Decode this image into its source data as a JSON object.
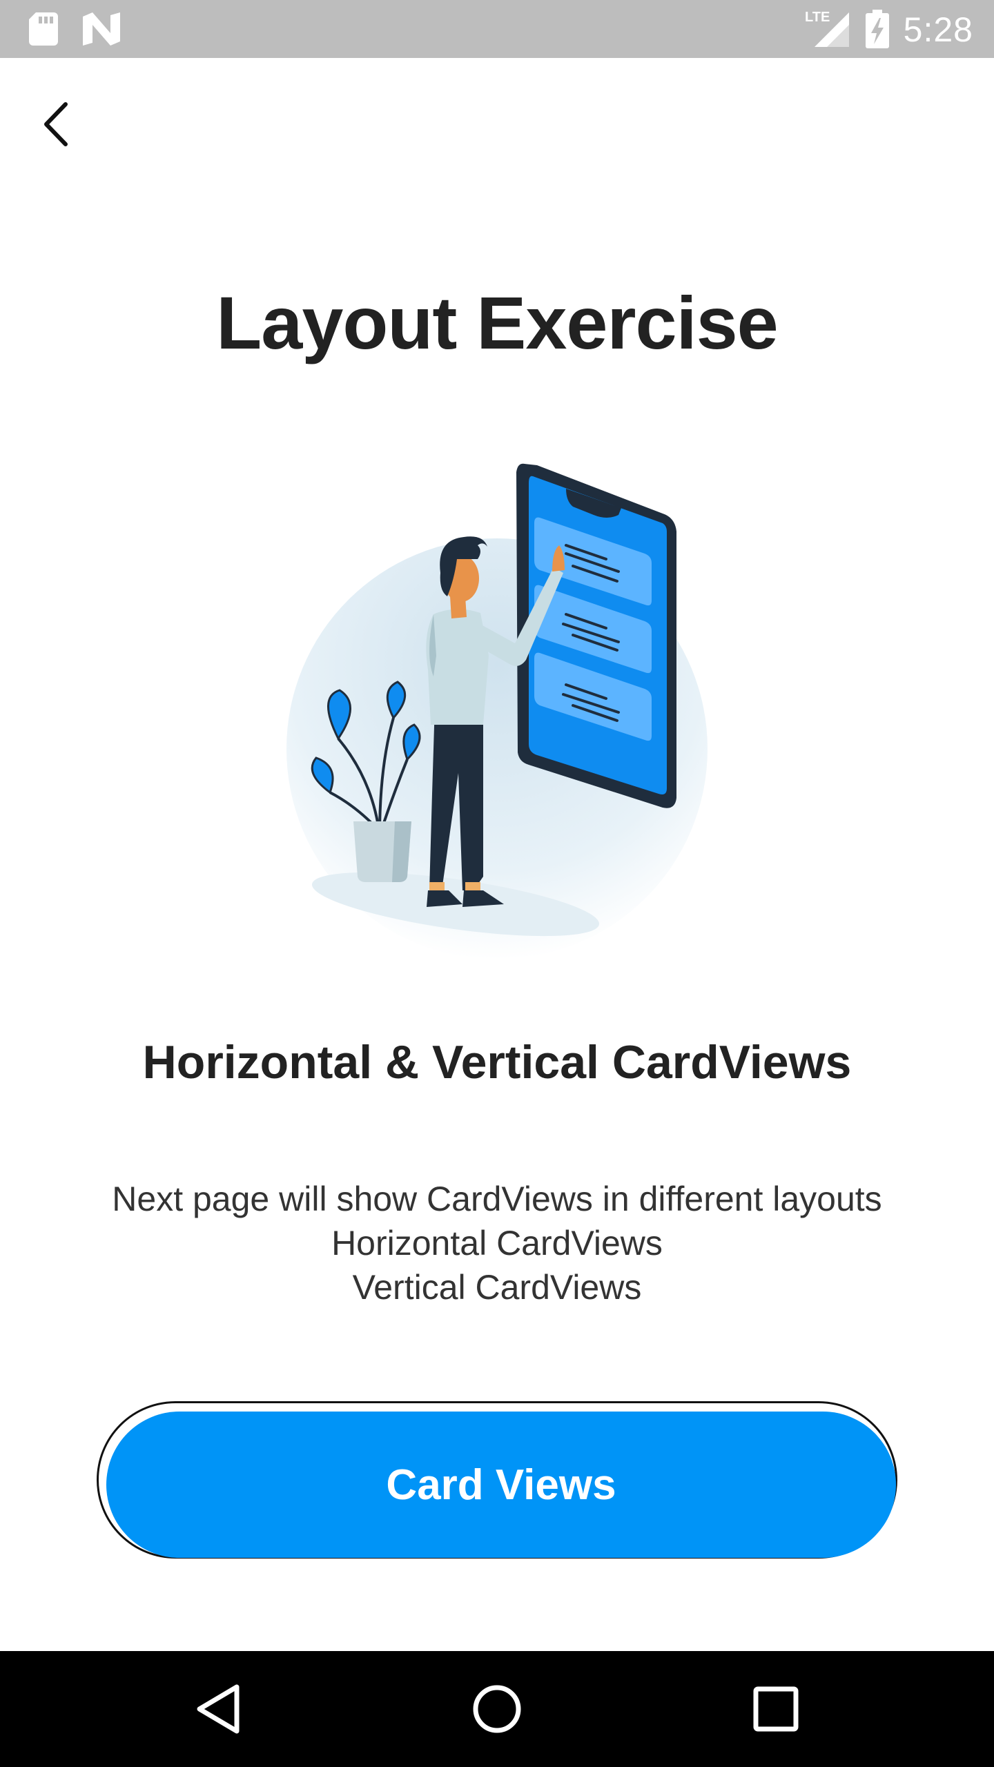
{
  "status_bar": {
    "network_label": "LTE",
    "time": "5:28"
  },
  "header": {
    "back_icon": "chevron-left-icon"
  },
  "main": {
    "title": "Layout Exercise",
    "section_heading": "Horizontal & Vertical CardViews",
    "description_lines": [
      "Next page will show CardViews in different layouts",
      "Horizontal CardViews",
      "Vertical CardViews"
    ],
    "cta_label": "Card Views"
  },
  "nav_bar": {
    "back_icon": "triangle-back-icon",
    "home_icon": "circle-home-icon",
    "recents_icon": "square-recents-icon"
  },
  "colors": {
    "accent": "#0094f7",
    "status_bar_bg": "#bdbdbd",
    "nav_bar_bg": "#000000",
    "text_dark": "#222222"
  }
}
